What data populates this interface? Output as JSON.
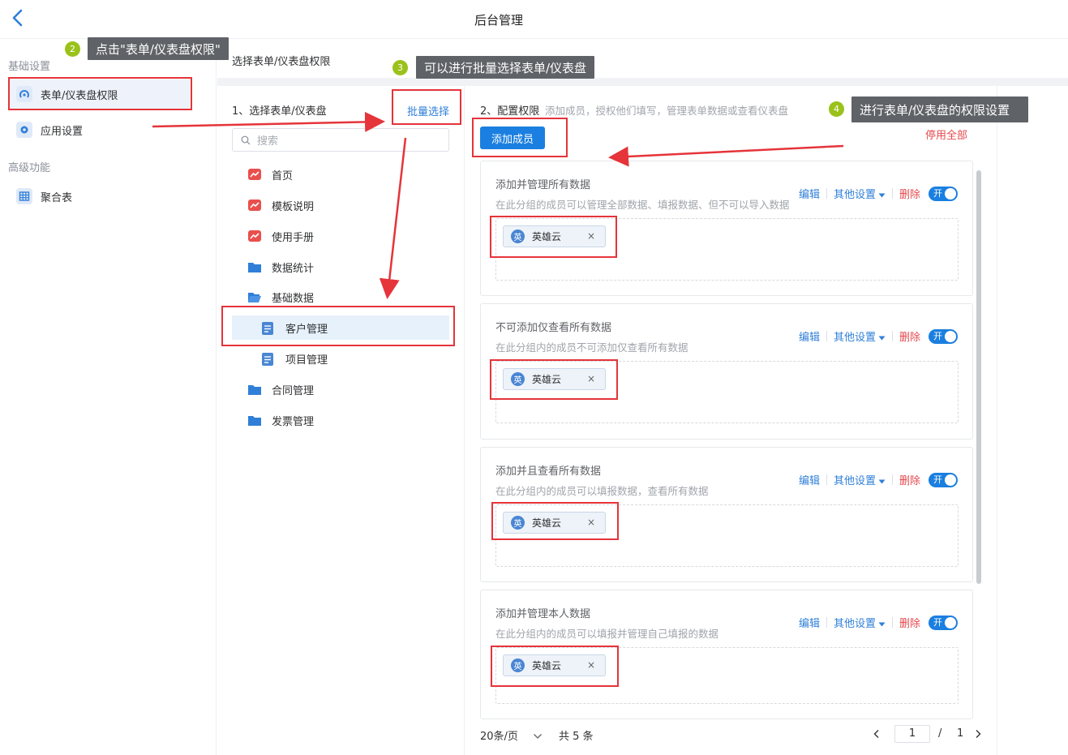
{
  "header": {
    "title": "后台管理"
  },
  "sidebar": {
    "section_basic": "基础设置",
    "section_advanced": "高级功能",
    "items": [
      {
        "label": "表单/仪表盘权限",
        "icon": "permission-icon"
      },
      {
        "label": "应用设置",
        "icon": "gear-icon"
      },
      {
        "label": "聚合表",
        "icon": "table-icon"
      }
    ]
  },
  "main": {
    "title": "选择表单/仪表盘权限"
  },
  "left_panel": {
    "step_title": "1、选择表单/仪表盘",
    "batch_select": "批量选择",
    "search_placeholder": "搜索",
    "tree": [
      {
        "label": "首页",
        "icon": "dashboard-icon"
      },
      {
        "label": "模板说明",
        "icon": "dashboard-icon"
      },
      {
        "label": "使用手册",
        "icon": "dashboard-icon"
      },
      {
        "label": "数据统计",
        "icon": "folder-icon"
      },
      {
        "label": "基础数据",
        "icon": "folder-open-icon"
      },
      {
        "label": "客户管理",
        "icon": "form-icon"
      },
      {
        "label": "项目管理",
        "icon": "form-icon"
      },
      {
        "label": "合同管理",
        "icon": "folder-icon"
      },
      {
        "label": "发票管理",
        "icon": "folder-icon"
      }
    ]
  },
  "right_panel": {
    "step_title": "2、配置权限",
    "step_hint": "添加成员，授权他们填写，管理表单数据或查看仪表盘",
    "add_member": "添加成员",
    "disable_all": "停用全部",
    "actions": {
      "edit": "编辑",
      "more": "其他设置",
      "delete": "删除",
      "toggle": "开"
    },
    "cards": [
      {
        "title": "添加并管理所有数据",
        "desc": "在此分组的成员可以管理全部数据、填报数据、但不可以导入数据",
        "member": "英雄云",
        "avatar": "英"
      },
      {
        "title": "不可添加仅查看所有数据",
        "desc": "在此分组内的成员不可添加仅查看所有数据",
        "member": "英雄云",
        "avatar": "英"
      },
      {
        "title": "添加并且查看所有数据",
        "desc": "在此分组内的成员可以填报数据，查看所有数据",
        "member": "英雄云",
        "avatar": "英"
      },
      {
        "title": "添加并管理本人数据",
        "desc": "在此分组内的成员可以填报并管理自己填报的数据",
        "member": "英雄云",
        "avatar": "英"
      }
    ]
  },
  "pagination": {
    "page_size": "20条/页",
    "total": "共 5 条",
    "current": "1",
    "separator": "/",
    "pages": "1"
  },
  "annotations": [
    {
      "num": "2",
      "text": "点击\"表单/仪表盘权限\""
    },
    {
      "num": "3",
      "text": "可以进行批量选择表单/仪表盘"
    },
    {
      "num": "4",
      "text": "进行表单/仪表盘的权限设置"
    }
  ],
  "colors": {
    "accent": "#1a7fe0",
    "danger": "#e5484d",
    "annotation": "#e5343a"
  }
}
